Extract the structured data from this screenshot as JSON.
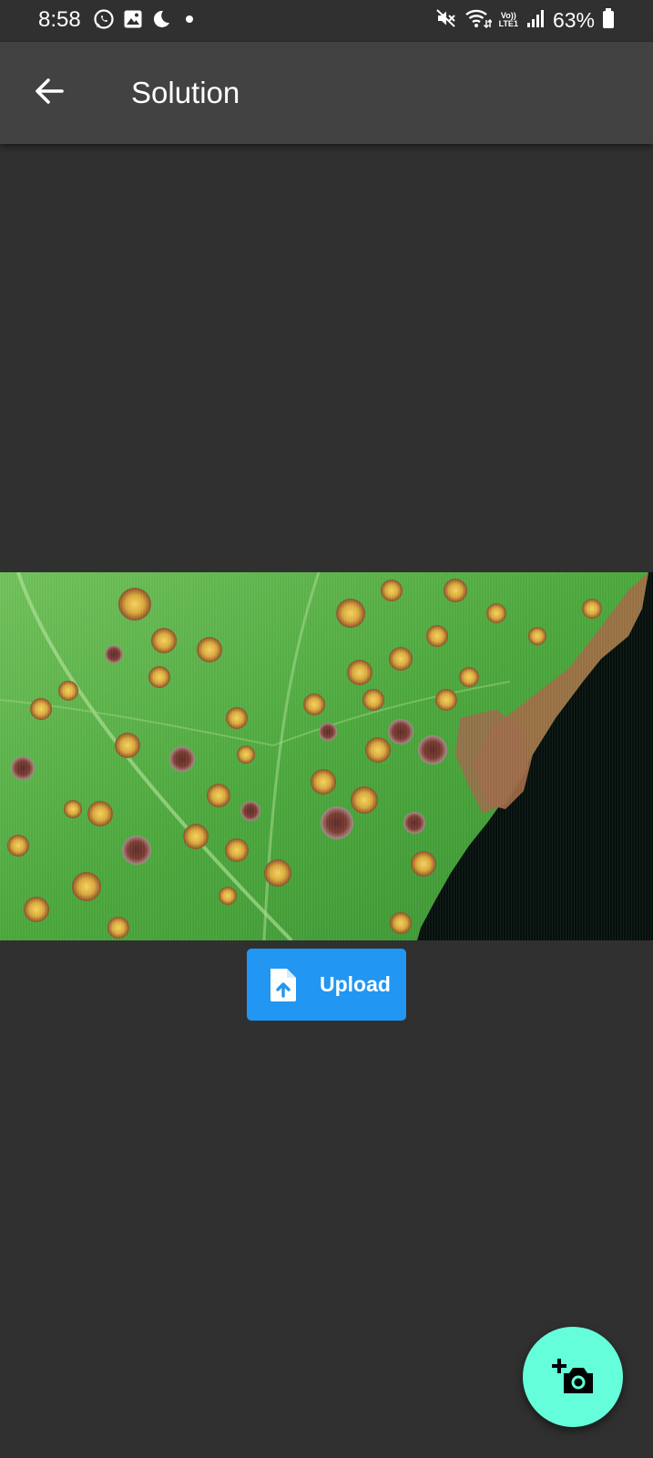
{
  "status_bar": {
    "time": "8:58",
    "battery_percent": "63%",
    "network_label_top": "Vo))",
    "network_label_bottom": "LTE1",
    "left_icons": [
      "whatsapp-icon",
      "gallery-icon",
      "moon-icon",
      "dot-icon"
    ],
    "right_icons": [
      "mute-icon",
      "wifi-icon",
      "signal-icon",
      "battery-icon"
    ]
  },
  "app_bar": {
    "title": "Solution",
    "back_icon": "arrow-back-icon",
    "background": "#424242"
  },
  "image": {
    "subject": "leaf with disease spots"
  },
  "upload_button": {
    "label": "Upload",
    "icon": "file-upload-icon",
    "color": "#2196f3"
  },
  "fab": {
    "icon": "add-a-photo-icon",
    "color": "#64ffda"
  },
  "colors": {
    "background": "#303030",
    "status_bar": "#303030"
  }
}
